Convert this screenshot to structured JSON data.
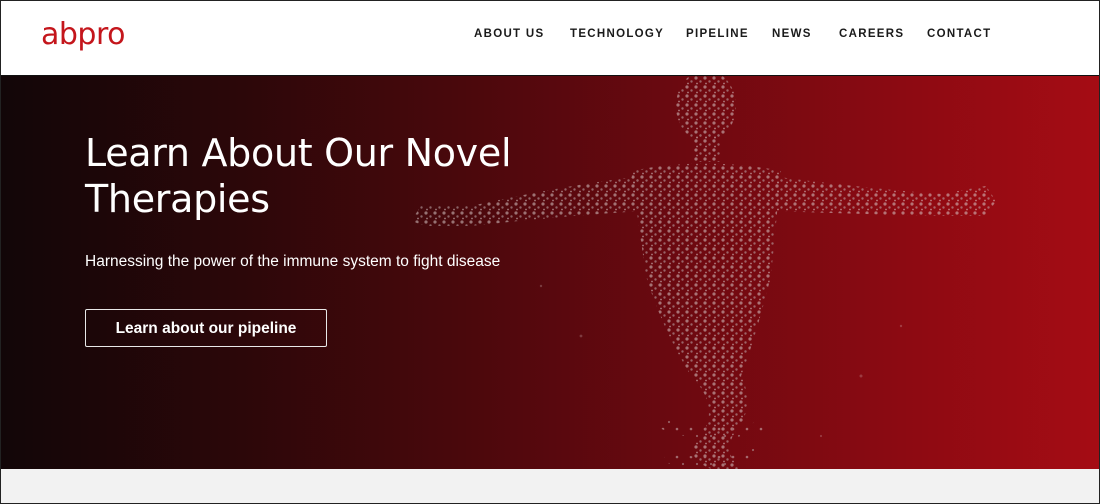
{
  "brand": {
    "logo_text": "abpro",
    "color": "#c4161c"
  },
  "nav": {
    "items": [
      {
        "label": "ABOUT US"
      },
      {
        "label": "TECHNOLOGY"
      },
      {
        "label": "PIPELINE"
      },
      {
        "label": "NEWS"
      },
      {
        "label": "CAREERS"
      },
      {
        "label": "CONTACT"
      }
    ]
  },
  "hero": {
    "headline": "Learn About Our Novel Therapies",
    "subheadline": "Harnessing the power of the immune system to fight disease",
    "cta_label": "Learn about our pipeline",
    "background_colors": [
      "#120608",
      "#a50c14"
    ],
    "image": "particle-human-figure-dna"
  }
}
